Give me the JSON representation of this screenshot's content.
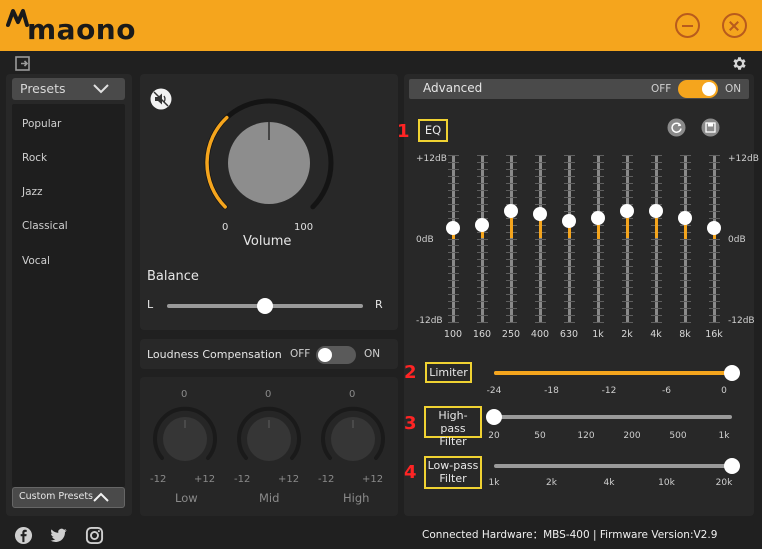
{
  "app": {
    "brand": "maono"
  },
  "presets": {
    "title": "Presets",
    "items": [
      "Popular",
      "Rock",
      "Jazz",
      "Classical",
      "Vocal"
    ],
    "custom_label": "Custom Presets"
  },
  "volume": {
    "label": "Volume",
    "min": "0",
    "max": "100",
    "value": 0.55
  },
  "balance": {
    "label": "Balance",
    "left": "L",
    "right": "R",
    "value": 0.5
  },
  "loudness": {
    "label": "Loudness Compensation",
    "off": "OFF",
    "on": "ON",
    "enabled": false
  },
  "knobs": [
    {
      "label": "Low",
      "value": "0",
      "min": "-12",
      "max": "+12"
    },
    {
      "label": "Mid",
      "value": "0",
      "min": "-12",
      "max": "+12"
    },
    {
      "label": "High",
      "value": "0",
      "min": "-12",
      "max": "+12"
    }
  ],
  "advanced": {
    "title": "Advanced",
    "off": "OFF",
    "on": "ON",
    "enabled": true,
    "eq_label": "EQ",
    "eq_top": "+12dB",
    "eq_mid": "0dB",
    "eq_bottom": "-12dB",
    "eq_bands": [
      {
        "freq": "100",
        "gain_db": 1.5
      },
      {
        "freq": "160",
        "gain_db": 2
      },
      {
        "freq": "250",
        "gain_db": 4
      },
      {
        "freq": "400",
        "gain_db": 3.5
      },
      {
        "freq": "630",
        "gain_db": 2.5
      },
      {
        "freq": "1k",
        "gain_db": 3
      },
      {
        "freq": "2k",
        "gain_db": 4
      },
      {
        "freq": "4k",
        "gain_db": 4
      },
      {
        "freq": "8k",
        "gain_db": 3
      },
      {
        "freq": "16k",
        "gain_db": 1.5
      }
    ],
    "limiter": {
      "label": "Limiter",
      "ticks": [
        "-24",
        "-18",
        "-12",
        "-6",
        "0"
      ],
      "value": 1.0,
      "number": "2"
    },
    "highpass": {
      "label_line1": "High-pass",
      "label_line2": "Filter",
      "ticks": [
        "20",
        "50",
        "120",
        "200",
        "500",
        "1k"
      ],
      "value": 0.0,
      "number": "3"
    },
    "lowpass": {
      "label_line1": "Low-pass",
      "label_line2": "Filter",
      "ticks": [
        "1k",
        "2k",
        "4k",
        "10k",
        "20k"
      ],
      "value": 1.0,
      "number": "4"
    },
    "eq_number": "1"
  },
  "footer": {
    "connected_label": "Connected Hardware：",
    "hardware": "MBS-400",
    "separator": "|",
    "firmware_label": "Firmware Version:",
    "firmware": "V2.9",
    "socials": [
      "facebook-icon",
      "twitter-icon",
      "instagram-icon"
    ]
  },
  "colors": {
    "accent": "#f5a51d",
    "highlight_box": "#f0d232",
    "marker": "#ff2424"
  }
}
